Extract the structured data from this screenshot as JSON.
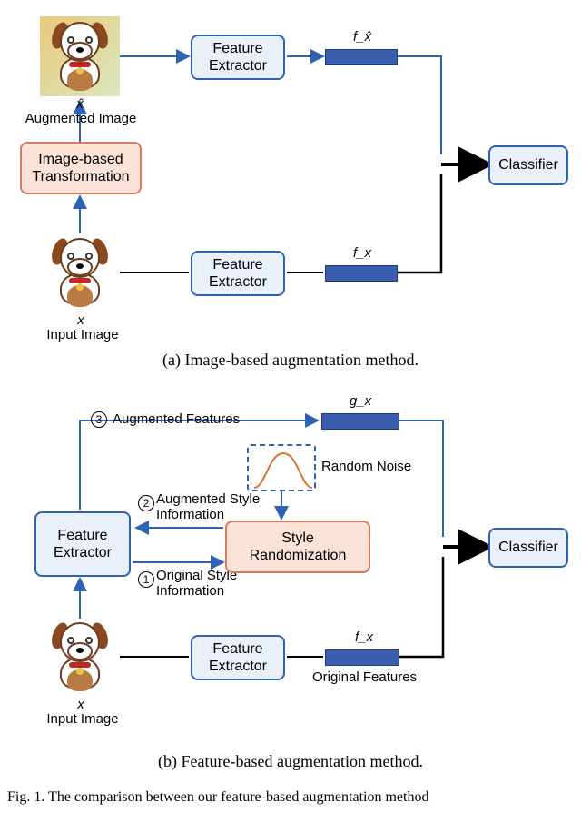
{
  "panel_a": {
    "augmented_img_label": "Augmented Image",
    "augmented_sym_top": "x̂",
    "transform_box": "Image-based\nTransformation",
    "input_img_label": "Input Image",
    "input_sym_top": "x",
    "feat_extractor": "Feature\nExtractor",
    "feat_aug_sym": "f_x̂",
    "feat_orig_sym": "f_x",
    "classifier": "Classifier",
    "caption": "(a) Image-based augmentation method."
  },
  "panel_b": {
    "step3_label": "Augmented Features",
    "step2_label": "Augmented Style\nInformation",
    "step1_label": "Original Style\nInformation",
    "random_noise_label": "Random Noise",
    "feat_extractor": "Feature\nExtractor",
    "style_random": "Style\nRandomization",
    "feat_aug_sym": "g_x",
    "feat_orig_sym": "f_x",
    "orig_feats_label": "Original Features",
    "classifier": "Classifier",
    "input_img_label": "Input Image",
    "input_sym_top": "x",
    "step_nums": {
      "s1": "1",
      "s2": "2",
      "s3": "3"
    },
    "caption": "(b) Feature-based augmentation method."
  },
  "figure_footer": "Fig. 1.    The comparison between our feature-based augmentation method"
}
